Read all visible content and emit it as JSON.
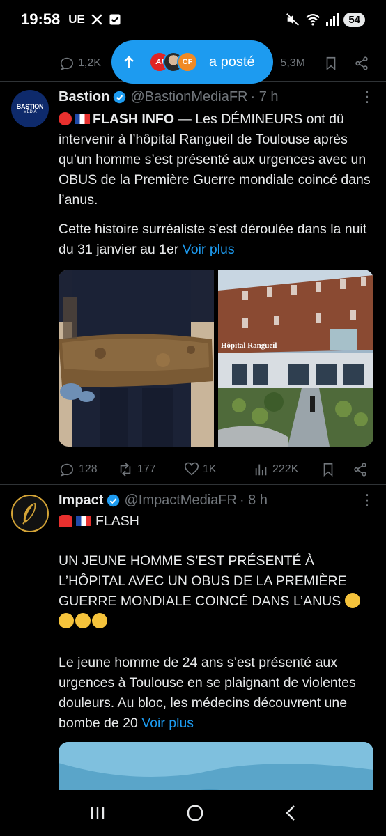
{
  "status_bar": {
    "time": "19:58",
    "icons_left": [
      "UE",
      "x-logo-icon",
      "check-box-icon"
    ],
    "battery": "54"
  },
  "previous_tweet": {
    "replies": "1,2K",
    "views": "5,3M"
  },
  "posted_pill": {
    "label": "a posté"
  },
  "tweets": [
    {
      "name": "Bastion",
      "handle": "@BastionMediaFR",
      "time": "· 7 h",
      "avatar_text": "BASTION",
      "avatar_sub": "MÉDIA",
      "flash_label": "FLASH INFO",
      "text_after_flash": " — Les DÉMINEURS ont dû intervenir à l’hôpital Rangueil de Toulouse après qu’un homme s’est présenté aux urgences avec un OBUS de la Première Guerre mondiale coincé dans l’anus.",
      "text2": "Cette histoire surréaliste s’est déroulée dans la nuit du 31 janvier au 1er",
      "see_more": "Voir plus",
      "image_caption": "Hôpital Rangueil",
      "stats": {
        "replies": "128",
        "reposts": "177",
        "likes": "1K",
        "views": "222K"
      }
    },
    {
      "name": "Impact",
      "handle": "@ImpactMediaFR",
      "time": "· 8 h",
      "flash_label": "FLASH",
      "text1": "UN JEUNE HOMME S’EST PRÉSENTÉ À L’HÔPITAL AVEC UN OBUS DE LA PREMIÈRE GUERRE MONDIALE COINCÉ DANS L’ANUS",
      "text2": "Le jeune homme de 24 ans s’est présenté aux urgences à Toulouse en se plaignant de violentes douleurs. Au bloc, les médecins découvrent une bombe de 20",
      "see_more": "Voir plus"
    }
  ],
  "colors": {
    "accent": "#1d9bf0",
    "muted": "#71767b",
    "text": "#e7e9ea",
    "divider": "#2f3336"
  }
}
